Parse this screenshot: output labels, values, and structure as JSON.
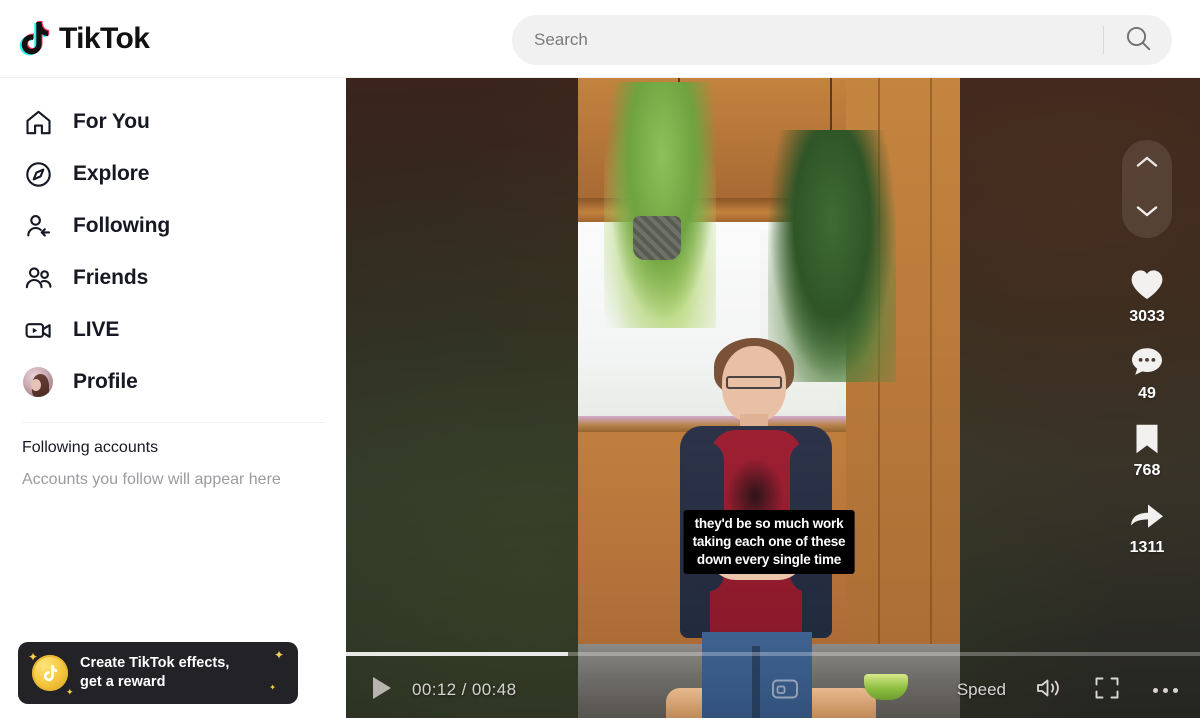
{
  "header": {
    "logo_text": "TikTok",
    "logo_icon": "tiktok-note-icon",
    "search": {
      "value": "",
      "placeholder": "Search",
      "button_icon": "search-icon"
    }
  },
  "sidebar": {
    "nav": [
      {
        "label": "For You",
        "icon": "home-icon"
      },
      {
        "label": "Explore",
        "icon": "compass-icon"
      },
      {
        "label": "Following",
        "icon": "person-arrow-icon"
      },
      {
        "label": "Friends",
        "icon": "two-people-icon"
      },
      {
        "label": "LIVE",
        "icon": "video-camera-icon"
      },
      {
        "label": "Profile",
        "icon": "avatar-icon"
      }
    ],
    "following_accounts": {
      "title": "Following accounts",
      "empty_text": "Accounts you follow will appear here"
    },
    "promo": {
      "icon": "tiktok-coin-icon",
      "line1": "Create TikTok effects,",
      "line2": "get a reward"
    }
  },
  "video": {
    "caption": "they'd be so much work\ntaking each one of these\ndown every single time",
    "actions": [
      {
        "name": "scroll-up",
        "icon": "chevron-up-icon"
      },
      {
        "name": "scroll-down",
        "icon": "chevron-down-icon"
      },
      {
        "name": "like",
        "icon": "heart-icon",
        "count": "3033"
      },
      {
        "name": "comment",
        "icon": "comment-icon",
        "count": "49"
      },
      {
        "name": "bookmark",
        "icon": "bookmark-icon",
        "count": "768"
      },
      {
        "name": "share",
        "icon": "share-arrow-icon",
        "count": "1311"
      }
    ],
    "controls": {
      "play_icon": "play-icon",
      "current_time": "00:12",
      "separator": " / ",
      "total_time": "00:48",
      "time_display": "00:12 / 00:48",
      "progress_percent": 26,
      "subtitle_icon": "subtitle-icon",
      "speed_label": "Speed",
      "volume_icon": "volume-icon",
      "fullscreen_icon": "fullscreen-icon",
      "more_icon": "more-options-icon"
    }
  },
  "colors": {
    "brand_black": "#161823",
    "brand_cyan": "#25F4EE",
    "brand_red": "#FE2C55",
    "search_bg": "#f1f1f2",
    "promo_bg": "#232327",
    "promo_gold": "#f5c73f",
    "muted_text": "#9b9ba0"
  }
}
